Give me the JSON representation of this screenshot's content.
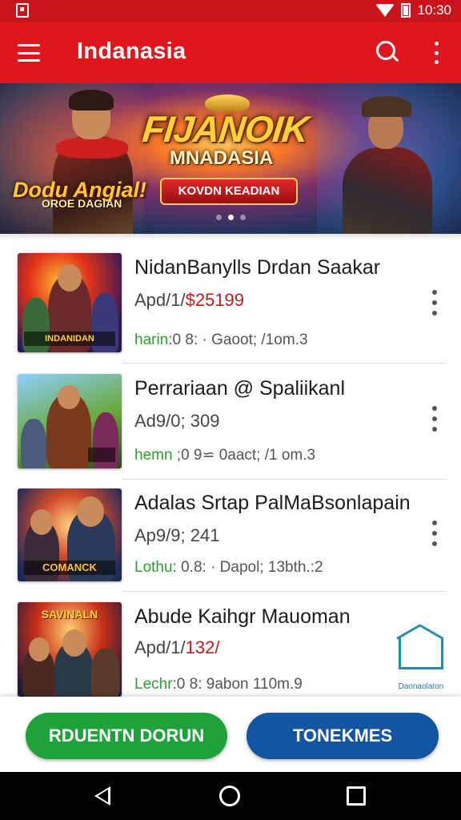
{
  "status_bar": {
    "time": "10:30"
  },
  "app_bar": {
    "title": "Indanasia"
  },
  "banner": {
    "logo_main": "FIJANOIK",
    "logo_sub": "MNADASIA",
    "ribbon": "KOVDN KEADIAN",
    "left_logo": "Dodu Angial!",
    "left_logo_sub": "OROE DAGIAN",
    "active_dot": 1,
    "dot_count": 3
  },
  "items": [
    {
      "title": "NidanBanylls Drdan Saakar",
      "price_prefix": "Apd/1/",
      "price_value": "$25199",
      "meta_label": "harin",
      "meta_rest": ":0 8: · Gaoot; /1om.3",
      "thumb_caption": "INDANIDAN"
    },
    {
      "title": "Perrariaan  @ Spaliikanl",
      "price_prefix": "Ad9/0; 309",
      "price_value": "",
      "meta_label": "hemn",
      "meta_rest": " ;0 9⋍ 0aact; /1 om.3",
      "thumb_caption": ""
    },
    {
      "title": "Adalas Srtap PalMaBsonlapain",
      "price_prefix": "Ap9/9; 241",
      "price_value": "",
      "meta_label": "Lothu",
      "meta_rest": ": 0.8: · Dapol; 13bth.:2",
      "thumb_caption": "COMANCK"
    },
    {
      "title": "Abude Kaihgr Mauoman",
      "price_prefix": "Apd/1/",
      "price_value": "132/",
      "meta_label": "Lechr",
      "meta_rest": ":0 8: 9abon 110m.9",
      "thumb_caption": "SAVINALN"
    }
  ],
  "watermark": {
    "text": "Daonaolaton"
  },
  "buttons": {
    "primary": "RDUENTN DORUN",
    "secondary": "TONEKMES"
  },
  "colors": {
    "app_bar": "#e0161d",
    "green": "#1ea33a",
    "blue": "#1455a3",
    "price_red": "#c41a1a",
    "meta_green": "#2e9e30"
  },
  "icons": [
    "menu-icon",
    "search-icon",
    "more-vert-icon",
    "wifi-icon",
    "battery-icon",
    "back-icon",
    "home-icon",
    "recents-icon"
  ]
}
